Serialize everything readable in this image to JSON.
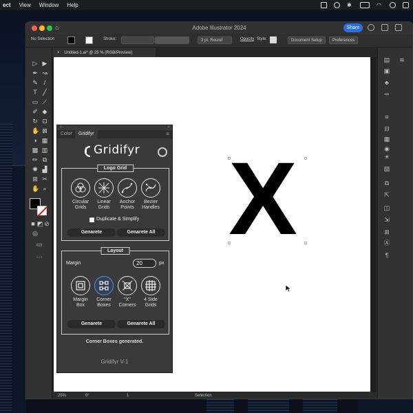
{
  "menubar": {
    "items": [
      "ect",
      "View",
      "Window",
      "Help"
    ]
  },
  "window": {
    "title": "Adobe Illustrator 2024",
    "share_label": "Share"
  },
  "control_bar": {
    "selection_text": "No Selection",
    "stroke_label": "Stroke:",
    "stroke_profile": "3 pt. Round",
    "opacity_label": "Opacity",
    "style_label": "Style:",
    "document_setup_label": "Document Setup",
    "preferences_label": "Preferences"
  },
  "document_tab": {
    "label": "Untitled-1.ai* @ 25 % (RGB/Preview)"
  },
  "artboard": {
    "glyph": "X"
  },
  "status_bar": {
    "zoom": "25%",
    "rotation": "0°",
    "artboard_index": "1",
    "tool_name": "Selection"
  },
  "panel": {
    "tabs": [
      "Color",
      "Gridifyr"
    ],
    "active_tab": "Gridifyr",
    "brand": "Gridifyr",
    "logo_grid": {
      "title": "Logo Grid",
      "options": [
        "Circular\nGrids",
        "Linear\nGrids",
        "Anchor\nPoints",
        "Bezier\nHandles"
      ],
      "checkbox_label": "Duplicate & Simplify",
      "generate_label": "Genarete",
      "generate_all_label": "Genarete All"
    },
    "layout": {
      "title": "Layout",
      "margin_label": "Margin",
      "margin_value": "20",
      "margin_unit": "px",
      "options": [
        "Margin\nBox",
        "Corner\nBoxes",
        "\"X\"\nCorners",
        "4 Side\nGrids"
      ],
      "selected_option": "Corner\nBoxes",
      "generate_label": "Genarete",
      "generate_all_label": "Genarete All"
    },
    "status_message": "Corner Boxes generated.",
    "version": "Gridifyr V-1"
  },
  "colors": {
    "accent_blue": "#2c6fe0",
    "panel_bg": "#3a3a3a",
    "selected_ring": "#5b8de0"
  }
}
